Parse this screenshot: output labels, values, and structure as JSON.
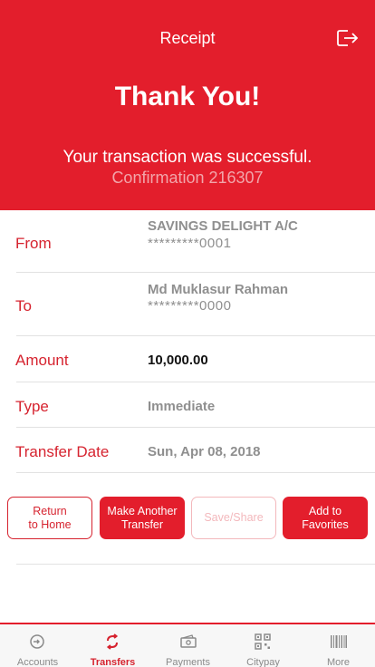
{
  "header": {
    "title": "Receipt",
    "heading": "Thank You!",
    "message": "Your transaction was successful.",
    "confirmation": "Confirmation 216307"
  },
  "details": {
    "from": {
      "label": "From",
      "account_name": "SAVINGS DELIGHT A/C",
      "account_number": "*********0001"
    },
    "to": {
      "label": "To",
      "name": "Md Muklasur Rahman",
      "account_number": "*********0000"
    },
    "amount": {
      "label": "Amount",
      "value": "10,000.00"
    },
    "type": {
      "label": "Type",
      "value": "Immediate"
    },
    "date": {
      "label": "Transfer Date",
      "value": "Sun, Apr 08, 2018"
    }
  },
  "actions": {
    "return_home": {
      "line1": "Return",
      "line2": "to Home"
    },
    "make_another": {
      "line1": "Make Another",
      "line2": "Transfer"
    },
    "save_share": {
      "label": "Save/Share"
    },
    "add_favorites": {
      "line1": "Add to",
      "line2": "Favorites"
    }
  },
  "tabbar": {
    "items": [
      {
        "label": "Accounts",
        "icon": "accounts-icon"
      },
      {
        "label": "Transfers",
        "icon": "transfers-icon",
        "active": true
      },
      {
        "label": "Payments",
        "icon": "payments-icon"
      },
      {
        "label": "Citypay",
        "icon": "qr-code-icon"
      },
      {
        "label": "More",
        "icon": "barcode-icon"
      }
    ]
  },
  "colors": {
    "brand_red": "#e31e2c",
    "label_red": "#d6232f",
    "muted_gray": "#8f8f8f"
  }
}
